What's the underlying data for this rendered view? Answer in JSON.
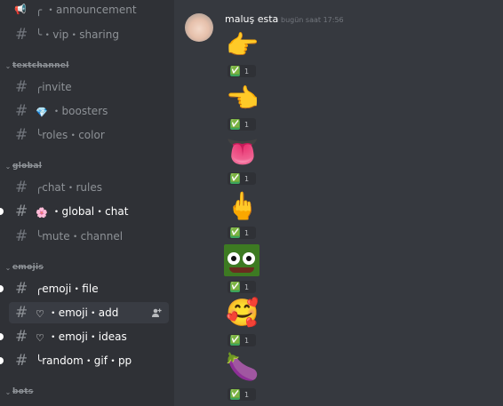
{
  "sidebar": {
    "channels": [
      {
        "label": "╭ ・announcement",
        "unread": false,
        "active": false
      },
      {
        "label": "╰・vip・sharing",
        "unread": false,
        "active": false
      },
      {
        "label": "╭invite",
        "unread": false,
        "active": false
      },
      {
        "label": "boosters",
        "prefix": "・",
        "emoji": "💎",
        "unread": false,
        "active": false
      },
      {
        "label": "╰roles・color",
        "unread": false,
        "active": false
      },
      {
        "label": "╭chat・rules",
        "unread": false,
        "active": false
      },
      {
        "label": "global・chat",
        "prefix": "・",
        "emoji": "🌸",
        "unread": true,
        "active": false
      },
      {
        "label": "╰mute・channel",
        "unread": false,
        "active": false
      },
      {
        "label": "╭emoji・file",
        "unread": true,
        "active": false
      },
      {
        "label": "emoji・add",
        "prefix": "・",
        "emoji": "♡",
        "unread": false,
        "active": true
      },
      {
        "label": "emoji・ideas",
        "prefix": "・",
        "emoji": "♡",
        "unread": true,
        "active": false
      },
      {
        "label": "╰random・gif・pp",
        "unread": true,
        "active": false
      }
    ],
    "categories": [
      {
        "label": "textchannel"
      },
      {
        "label": "global"
      },
      {
        "label": "emojis"
      },
      {
        "label": "bots"
      }
    ]
  },
  "message": {
    "author": "maluş esta",
    "timestamp": "bugün saat 17:56",
    "stickers": [
      {
        "emoji": "👉",
        "reaction_emoji": "✅",
        "reaction_count": "1"
      },
      {
        "emoji": "👈",
        "reaction_emoji": "✅",
        "reaction_count": "1"
      },
      {
        "emoji": "👅",
        "reaction_emoji": "✅",
        "reaction_count": "1"
      },
      {
        "emoji": "🖕",
        "reaction_emoji": "✅",
        "reaction_count": "1"
      },
      {
        "emoji": "pepe",
        "reaction_emoji": "✅",
        "reaction_count": "1"
      },
      {
        "emoji": "🥰",
        "reaction_emoji": "✅",
        "reaction_count": "1"
      },
      {
        "emoji": "🍆",
        "reaction_emoji": "✅",
        "reaction_count": "1"
      }
    ]
  },
  "colors": {
    "sidebar_bg": "#2f3136",
    "chat_bg": "#36393f",
    "reaction_check": "#3ba55c"
  }
}
